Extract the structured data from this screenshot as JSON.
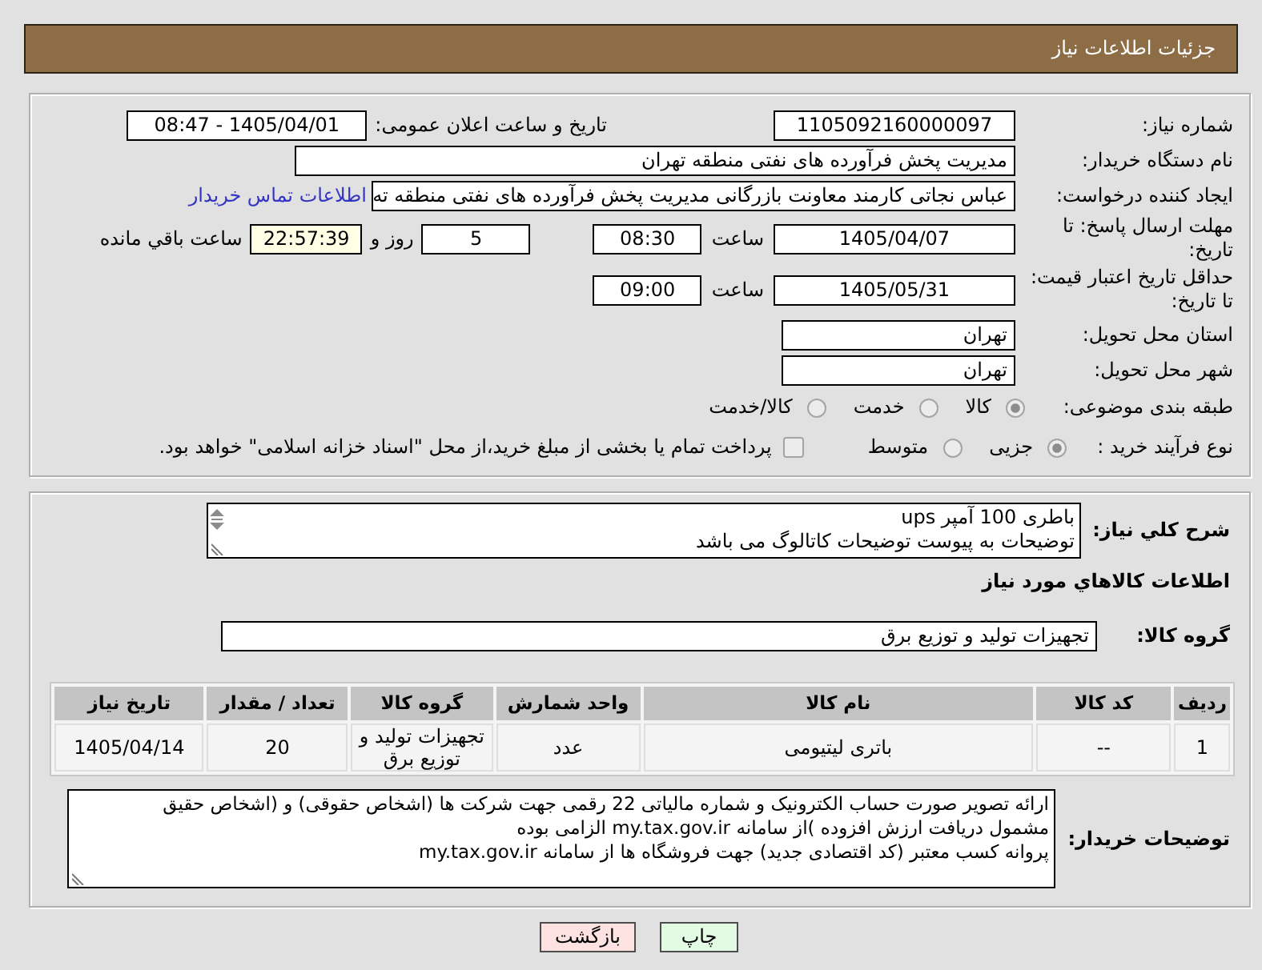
{
  "header": {
    "title": "جزئیات اطلاعات نیاز"
  },
  "details": {
    "need_number": {
      "label": "شماره نیاز:",
      "value": "1105092160000097"
    },
    "announcement": {
      "label": "تاریخ و ساعت اعلان عمومی:",
      "value": "1405/04/01 - 08:47"
    },
    "buyer_organization": {
      "label": "نام دستگاه خریدار:",
      "value": "مدیریت پخش فرآورده های نفتی منطقه تهران"
    },
    "requester": {
      "label": "ایجاد کننده درخواست:",
      "value": "عباس نجاتی کارمند معاونت بازرگانی مدیریت پخش فرآورده های نفتی منطقه ته",
      "contact_link": "اطلاعات تماس خریدار"
    },
    "response_deadline": {
      "label": "مهلت ارسال پاسخ: تا تاریخ:",
      "date": "1405/04/07",
      "time_label": "ساعت",
      "time": "08:30",
      "days": "5",
      "days_label": "روز و",
      "remaining_time": "22:57:39",
      "remaining_label": "ساعت باقي مانده"
    },
    "price_validity": {
      "label": "حداقل تاریخ اعتبار قیمت: تا تاریخ:",
      "date": "1405/05/31",
      "time_label": "ساعت",
      "time": "09:00"
    },
    "delivery_province": {
      "label": "استان محل تحویل:",
      "value": "تهران"
    },
    "delivery_city": {
      "label": "شهر محل تحویل:",
      "value": "تهران"
    },
    "subject_category": {
      "label": "طبقه بندی موضوعی:",
      "options": [
        {
          "label": "کالا",
          "selected": true
        },
        {
          "label": "خدمت",
          "selected": false
        },
        {
          "label": "کالا/خدمت",
          "selected": false
        }
      ]
    },
    "purchase_process": {
      "label": "نوع فرآیند خرید :",
      "options": [
        {
          "label": "جزیی",
          "selected": true
        },
        {
          "label": "متوسط",
          "selected": false
        }
      ],
      "treasury_payment": {
        "label": "پرداخت تمام یا بخشی از مبلغ خرید،از محل \"اسناد خزانه اسلامی\" خواهد بود.",
        "checked": false
      }
    }
  },
  "needs": {
    "description": {
      "label": "شرح کلي نیاز:",
      "text": "باطری 100 آمپر ups\nتوضیحات به پیوست توضیحات کاتالوگ می باشد"
    },
    "goods_title": "اطلاعات کالاهاي مورد نیاز",
    "goods_group": {
      "label": "گروه کالا:",
      "value": "تجهیزات تولید و توزیع برق"
    },
    "table": {
      "columns": [
        "ردیف",
        "کد کالا",
        "نام کالا",
        "واحد شمارش",
        "گروه کالا",
        "تعداد / مقدار",
        "تاریخ نیاز"
      ],
      "rows": [
        [
          "1",
          "--",
          "باتری لیتیومی",
          "عدد",
          "تجهیزات تولید و توزیع برق",
          "20",
          "1405/04/14"
        ]
      ]
    },
    "buyer_notes": {
      "label": "توضیحات خریدار:",
      "text": "ارائه  تصویر صورت حساب الکترونیک و شماره مالیاتی 22 رقمی  جهت شرکت ها (اشخاص حقوقی) و (اشخاص حقیق\nمشمول دریافت ارزش افزوده )از سامانه my.tax.gov.ir  الزامی بوده\nپروانه کسب معتبر (کد اقتصادی جدید) جهت فروشگاه ها از سامانه my.tax.gov.ir"
    }
  },
  "buttons": [
    {
      "label": "چاپ",
      "kind": "print"
    },
    {
      "label": "بازگشت",
      "kind": "back"
    }
  ]
}
